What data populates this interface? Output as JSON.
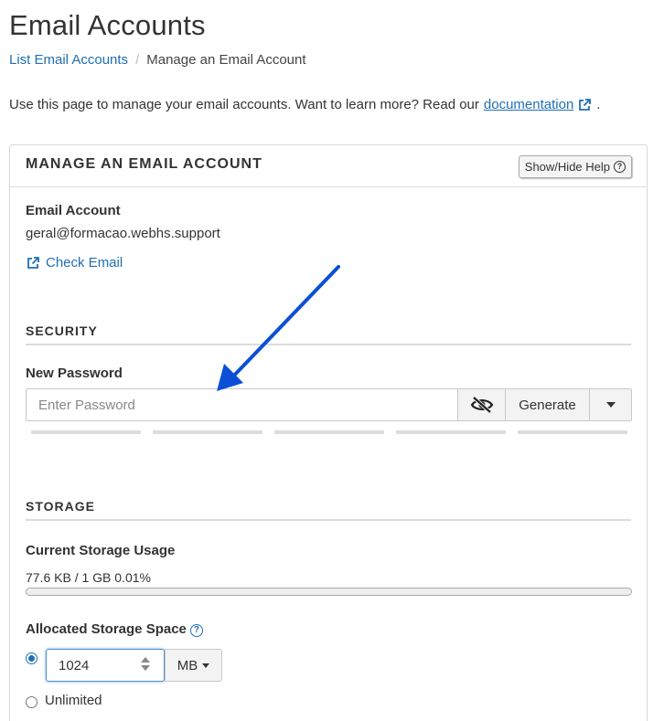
{
  "page": {
    "title": "Email Accounts"
  },
  "breadcrumb": {
    "link_label": "List Email Accounts",
    "separator": "/",
    "current": "Manage an Email Account"
  },
  "intro": {
    "text": "Use this page to manage your email accounts. Want to learn more? Read our",
    "link_label": "documentation",
    "suffix": "."
  },
  "panel": {
    "title": "MANAGE AN EMAIL ACCOUNT",
    "help_button_label": "Show/Hide Help",
    "email_account_label": "Email Account",
    "email_account_value": "geral@formacao.webhs.support",
    "check_email_label": "Check Email"
  },
  "security": {
    "section_title": "SECURITY",
    "new_password_label": "New Password",
    "password_placeholder": "Enter Password",
    "password_value": "",
    "toggle_visibility_icon": "eye-slash-icon",
    "generate_label": "Generate",
    "strength_segments": 5,
    "strength_filled": 0
  },
  "storage": {
    "section_title": "STORAGE",
    "current_usage_label": "Current Storage Usage",
    "current_usage_value": "77.6 KB / 1 GB 0.01%",
    "usage_fraction": 0.0001,
    "allocated_label": "Allocated Storage Space",
    "quota_value": "1024",
    "unit_label": "MB",
    "unlimited_label": "Unlimited",
    "selected_option": "custom"
  },
  "annotation": {
    "arrow_color": "#0a4fd6"
  },
  "colors": {
    "link": "#1f6fb5",
    "text": "#333333",
    "border": "#d8d8d8"
  }
}
